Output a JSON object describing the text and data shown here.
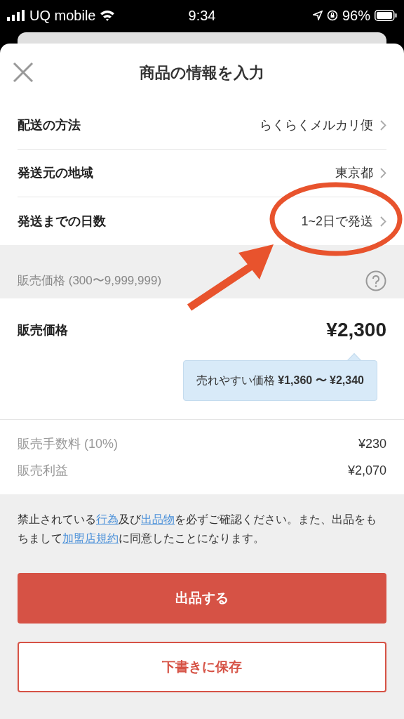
{
  "status_bar": {
    "carrier": "UQ mobile",
    "time": "9:34",
    "battery": "96%"
  },
  "header": {
    "title": "商品の情報を入力"
  },
  "shipping_rows": [
    {
      "label": "配送の方法",
      "value": "らくらくメルカリ便"
    },
    {
      "label": "発送元の地域",
      "value": "東京都"
    },
    {
      "label": "発送までの日数",
      "value": "1~2日で発送"
    }
  ],
  "price_section": {
    "range_label": "販売価格 (300〜9,999,999)",
    "label": "販売価格",
    "value": "¥2,300",
    "tooltip": "売れやすい価格 **¥1,360 〜 ¥2,340**"
  },
  "fees": [
    {
      "label": "販売手数料 (10%)",
      "value": "¥230"
    },
    {
      "label": "販売利益",
      "value": "¥2,070"
    }
  ],
  "notice": [
    {
      "text": "禁止されている",
      "link": false
    },
    {
      "text": "行為",
      "link": true
    },
    {
      "text": "及び",
      "link": false
    },
    {
      "text": "出品物",
      "link": true
    },
    {
      "text": "を必ずご確認ください。また、出品をもちまして",
      "link": false
    },
    {
      "text": "加盟店規約",
      "link": true
    },
    {
      "text": "に同意したことになります。",
      "link": false
    }
  ],
  "buttons": [
    {
      "label": "出品する",
      "kind": "primary"
    },
    {
      "label": "下書きに保存",
      "kind": "secondary"
    }
  ]
}
